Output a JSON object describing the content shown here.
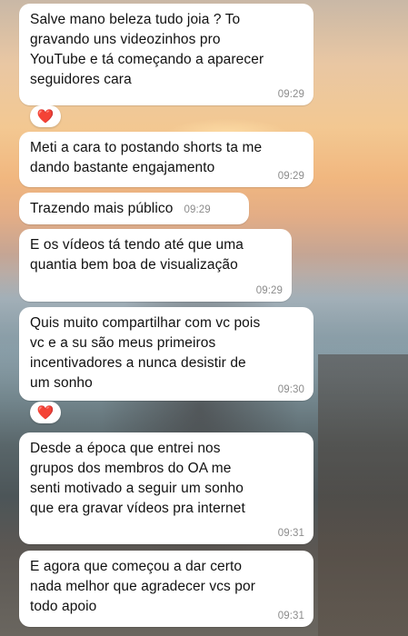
{
  "messages": [
    {
      "text": "Salve mano beleza tudo joia ? To\ngravando uns videozinhos pro\nYouTube e tá começando a aparecer\nseguidores cara",
      "time": "09:29",
      "reaction": "❤️"
    },
    {
      "text": "Meti a cara to postando shorts ta me\ndando bastante engajamento",
      "time": "09:29"
    },
    {
      "text": "Trazendo mais público",
      "time": "09:29"
    },
    {
      "text": "E os vídeos tá tendo até que uma\nquantia bem boa de visualização",
      "time": "09:29"
    },
    {
      "text": "Quis muito compartilhar com vc pois\nvc e a su são meus primeiros\nincentivadores a nunca desistir de\num sonho",
      "time": "09:30",
      "reaction": "❤️"
    },
    {
      "text": "Desde a época que entrei nos\ngrupos dos membros do OA me\nsenti motivado a seguir um sonho\nque era gravar vídeos pra internet",
      "time": "09:31"
    },
    {
      "text": "E agora que começou a dar certo\nnada melhor que agradecer vcs por\ntodo apoio",
      "time": "09:31"
    }
  ],
  "reaction_icon": "heart-icon",
  "colors": {
    "bubble": "#ffffff",
    "time": "#8c8c8c",
    "heart": "#e0245e"
  }
}
